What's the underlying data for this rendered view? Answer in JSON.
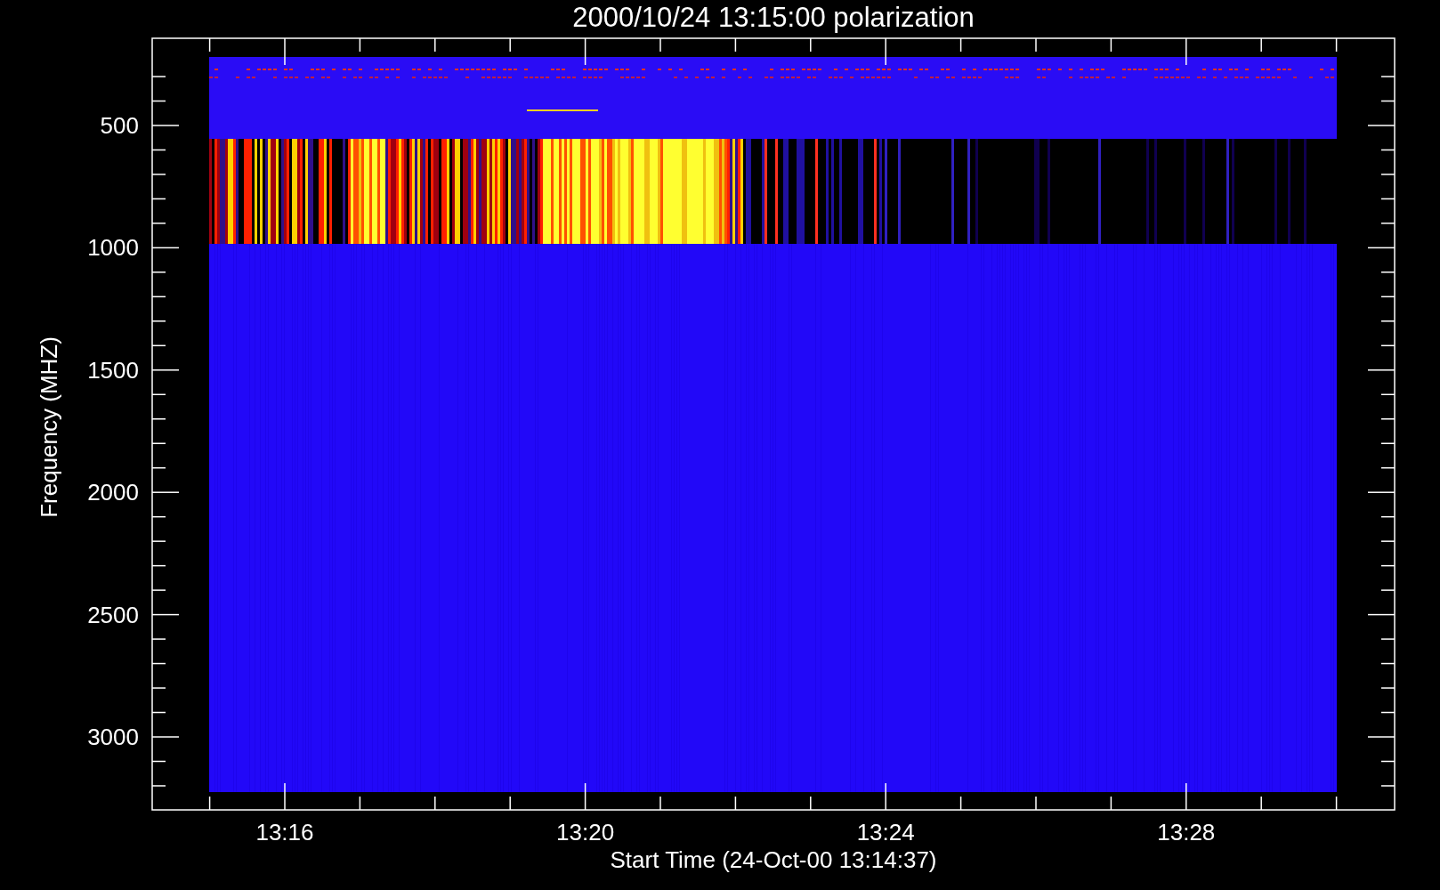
{
  "plot": {
    "title": "2000/10/24 13:15:00 polarization",
    "ylabel": "Frequency (MHZ)",
    "xlabel": "Start Time (24-Oct-00 13:14:37)",
    "yticks": [
      "500",
      "1000",
      "1500",
      "2000",
      "2500",
      "3000"
    ],
    "xticks": [
      "13:16",
      "13:20",
      "13:24",
      "13:28"
    ]
  }
}
